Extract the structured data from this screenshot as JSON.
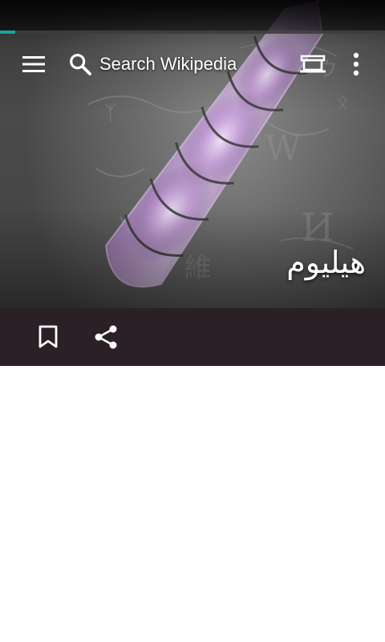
{
  "status_bar": {
    "load_progress": 0.04
  },
  "colors": {
    "progress_accent": "#1aa39a",
    "action_bar_bg": "#2a2026",
    "tube_glow": "#c9a3dc"
  },
  "toolbar": {
    "menu_icon": "hamburger-menu-icon",
    "search_icon": "search-icon",
    "search_placeholder": "Search Wikipedia",
    "reading_list_icon": "reading-list-icon",
    "overflow_icon": "overflow-menu-icon"
  },
  "article": {
    "title": "هيليوم",
    "lead_image_description_icon": "helium-discharge-tube-image"
  },
  "action_bar": {
    "bookmark_icon": "bookmark-icon",
    "share_icon": "share-icon"
  }
}
